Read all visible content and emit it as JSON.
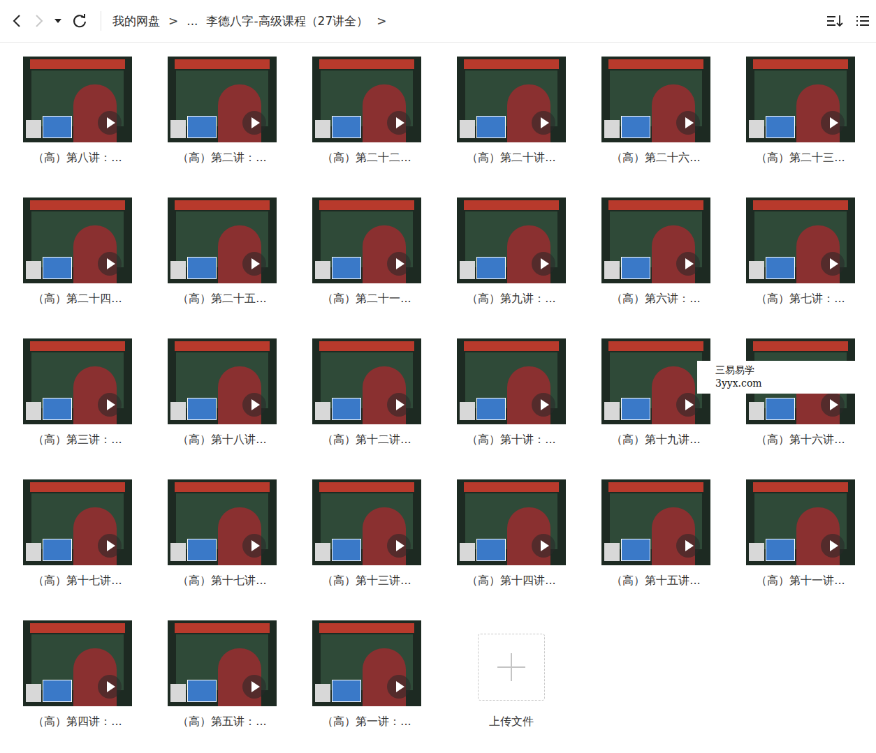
{
  "toolbar": {
    "back": {
      "disabled": false
    },
    "forward": {
      "disabled": true
    },
    "breadcrumb": [
      {
        "label": "我的网盘",
        "kind": "link"
      },
      {
        "label": ">",
        "kind": "separator"
      },
      {
        "label": "...",
        "kind": "link"
      },
      {
        "label": "李德八字-高级课程（27讲全）",
        "kind": "current"
      },
      {
        "label": ">",
        "kind": "separator"
      }
    ]
  },
  "files": [
    {
      "name": "（高）第八讲：..."
    },
    {
      "name": "（高）第二讲：..."
    },
    {
      "name": "（高）第二十二..."
    },
    {
      "name": "（高）第二十讲..."
    },
    {
      "name": "（高）第二十六..."
    },
    {
      "name": "（高）第二十三..."
    },
    {
      "name": "（高）第二十四..."
    },
    {
      "name": "（高）第二十五..."
    },
    {
      "name": "（高）第二十一..."
    },
    {
      "name": "（高）第九讲：..."
    },
    {
      "name": "（高）第六讲：..."
    },
    {
      "name": "（高）第七讲：..."
    },
    {
      "name": "（高）第三讲：..."
    },
    {
      "name": "（高）第十八讲..."
    },
    {
      "name": "（高）第十二讲..."
    },
    {
      "name": "（高）第十讲：..."
    },
    {
      "name": "（高）第十九讲..."
    },
    {
      "name": "（高）第十六讲...",
      "watermark": [
        "三易易学",
        "3yyx.com"
      ]
    },
    {
      "name": "（高）第十七讲..."
    },
    {
      "name": "（高）第十七讲..."
    },
    {
      "name": "（高）第十三讲..."
    },
    {
      "name": "（高）第十四讲..."
    },
    {
      "name": "（高）第十五讲..."
    },
    {
      "name": "（高）第十一讲..."
    },
    {
      "name": "（高）第四讲：..."
    },
    {
      "name": "（高）第五讲：..."
    },
    {
      "name": "（高）第一讲：..."
    }
  ],
  "upload": {
    "label": "上传文件"
  }
}
